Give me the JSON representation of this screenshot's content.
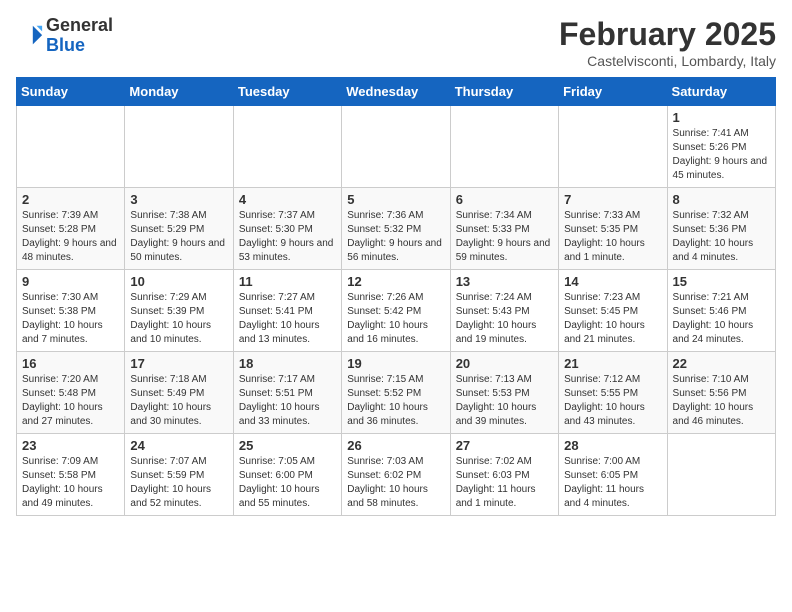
{
  "header": {
    "logo_general": "General",
    "logo_blue": "Blue",
    "month_year": "February 2025",
    "location": "Castelvisconti, Lombardy, Italy"
  },
  "weekdays": [
    "Sunday",
    "Monday",
    "Tuesday",
    "Wednesday",
    "Thursday",
    "Friday",
    "Saturday"
  ],
  "weeks": [
    [
      null,
      null,
      null,
      null,
      null,
      null,
      {
        "day": "1",
        "info": "Sunrise: 7:41 AM\nSunset: 5:26 PM\nDaylight: 9 hours and 45 minutes."
      }
    ],
    [
      {
        "day": "2",
        "info": "Sunrise: 7:39 AM\nSunset: 5:28 PM\nDaylight: 9 hours and 48 minutes."
      },
      {
        "day": "3",
        "info": "Sunrise: 7:38 AM\nSunset: 5:29 PM\nDaylight: 9 hours and 50 minutes."
      },
      {
        "day": "4",
        "info": "Sunrise: 7:37 AM\nSunset: 5:30 PM\nDaylight: 9 hours and 53 minutes."
      },
      {
        "day": "5",
        "info": "Sunrise: 7:36 AM\nSunset: 5:32 PM\nDaylight: 9 hours and 56 minutes."
      },
      {
        "day": "6",
        "info": "Sunrise: 7:34 AM\nSunset: 5:33 PM\nDaylight: 9 hours and 59 minutes."
      },
      {
        "day": "7",
        "info": "Sunrise: 7:33 AM\nSunset: 5:35 PM\nDaylight: 10 hours and 1 minute."
      },
      {
        "day": "8",
        "info": "Sunrise: 7:32 AM\nSunset: 5:36 PM\nDaylight: 10 hours and 4 minutes."
      }
    ],
    [
      {
        "day": "9",
        "info": "Sunrise: 7:30 AM\nSunset: 5:38 PM\nDaylight: 10 hours and 7 minutes."
      },
      {
        "day": "10",
        "info": "Sunrise: 7:29 AM\nSunset: 5:39 PM\nDaylight: 10 hours and 10 minutes."
      },
      {
        "day": "11",
        "info": "Sunrise: 7:27 AM\nSunset: 5:41 PM\nDaylight: 10 hours and 13 minutes."
      },
      {
        "day": "12",
        "info": "Sunrise: 7:26 AM\nSunset: 5:42 PM\nDaylight: 10 hours and 16 minutes."
      },
      {
        "day": "13",
        "info": "Sunrise: 7:24 AM\nSunset: 5:43 PM\nDaylight: 10 hours and 19 minutes."
      },
      {
        "day": "14",
        "info": "Sunrise: 7:23 AM\nSunset: 5:45 PM\nDaylight: 10 hours and 21 minutes."
      },
      {
        "day": "15",
        "info": "Sunrise: 7:21 AM\nSunset: 5:46 PM\nDaylight: 10 hours and 24 minutes."
      }
    ],
    [
      {
        "day": "16",
        "info": "Sunrise: 7:20 AM\nSunset: 5:48 PM\nDaylight: 10 hours and 27 minutes."
      },
      {
        "day": "17",
        "info": "Sunrise: 7:18 AM\nSunset: 5:49 PM\nDaylight: 10 hours and 30 minutes."
      },
      {
        "day": "18",
        "info": "Sunrise: 7:17 AM\nSunset: 5:51 PM\nDaylight: 10 hours and 33 minutes."
      },
      {
        "day": "19",
        "info": "Sunrise: 7:15 AM\nSunset: 5:52 PM\nDaylight: 10 hours and 36 minutes."
      },
      {
        "day": "20",
        "info": "Sunrise: 7:13 AM\nSunset: 5:53 PM\nDaylight: 10 hours and 39 minutes."
      },
      {
        "day": "21",
        "info": "Sunrise: 7:12 AM\nSunset: 5:55 PM\nDaylight: 10 hours and 43 minutes."
      },
      {
        "day": "22",
        "info": "Sunrise: 7:10 AM\nSunset: 5:56 PM\nDaylight: 10 hours and 46 minutes."
      }
    ],
    [
      {
        "day": "23",
        "info": "Sunrise: 7:09 AM\nSunset: 5:58 PM\nDaylight: 10 hours and 49 minutes."
      },
      {
        "day": "24",
        "info": "Sunrise: 7:07 AM\nSunset: 5:59 PM\nDaylight: 10 hours and 52 minutes."
      },
      {
        "day": "25",
        "info": "Sunrise: 7:05 AM\nSunset: 6:00 PM\nDaylight: 10 hours and 55 minutes."
      },
      {
        "day": "26",
        "info": "Sunrise: 7:03 AM\nSunset: 6:02 PM\nDaylight: 10 hours and 58 minutes."
      },
      {
        "day": "27",
        "info": "Sunrise: 7:02 AM\nSunset: 6:03 PM\nDaylight: 11 hours and 1 minute."
      },
      {
        "day": "28",
        "info": "Sunrise: 7:00 AM\nSunset: 6:05 PM\nDaylight: 11 hours and 4 minutes."
      },
      null
    ]
  ]
}
